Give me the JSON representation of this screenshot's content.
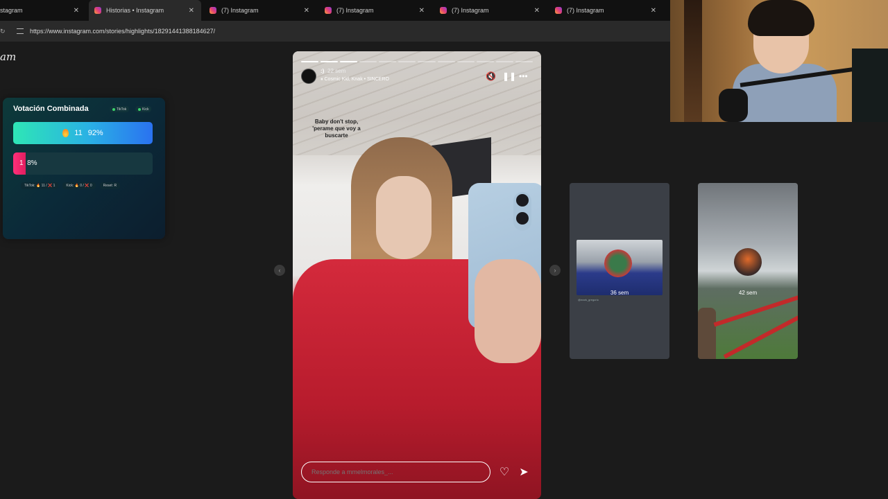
{
  "browser": {
    "tabs": [
      {
        "title": "stagram"
      },
      {
        "title": "Historias • Instagram"
      },
      {
        "title": "(7) Instagram"
      },
      {
        "title": "(7) Instagram"
      },
      {
        "title": "(7) Instagram"
      },
      {
        "title": "(7) Instagram"
      }
    ],
    "url": "https://www.instagram.com/stories/highlights/18291441388184627/"
  },
  "instagram": {
    "logo": "am"
  },
  "vote_widget": {
    "title": "Votación Combinada",
    "platform_tiktok": "TikTok",
    "platform_kick": "Kick",
    "option1": {
      "count": "11",
      "percent": "92%"
    },
    "option2": {
      "count": "1",
      "percent": "8%"
    },
    "stat_tiktok": "TikTok: 🔥 11 / ❌ 1",
    "stat_kick": "Kick: 🔥 0 / ❌ 0",
    "stat_reset": "Reset: R"
  },
  "story": {
    "username": ":)",
    "time": "22 sem",
    "music": "Cosmic Kid, Knak • SINCERO",
    "overlay_text": "Baby don't stop, 'perame que voy a buscarte",
    "reply_placeholder": "Responde a mmelmorales_...",
    "progress_total": 12,
    "progress_done": 3
  },
  "thumbnails": [
    {
      "label": "36 sem",
      "caption": "@mark_gregorio"
    },
    {
      "label": "42 sem"
    }
  ],
  "icons": {
    "mute": "mute-icon",
    "pause": "pause-icon",
    "more": "more-icon",
    "heart": "heart-icon",
    "send": "send-icon",
    "prev": "chevron-left-icon",
    "next": "chevron-right-icon"
  }
}
